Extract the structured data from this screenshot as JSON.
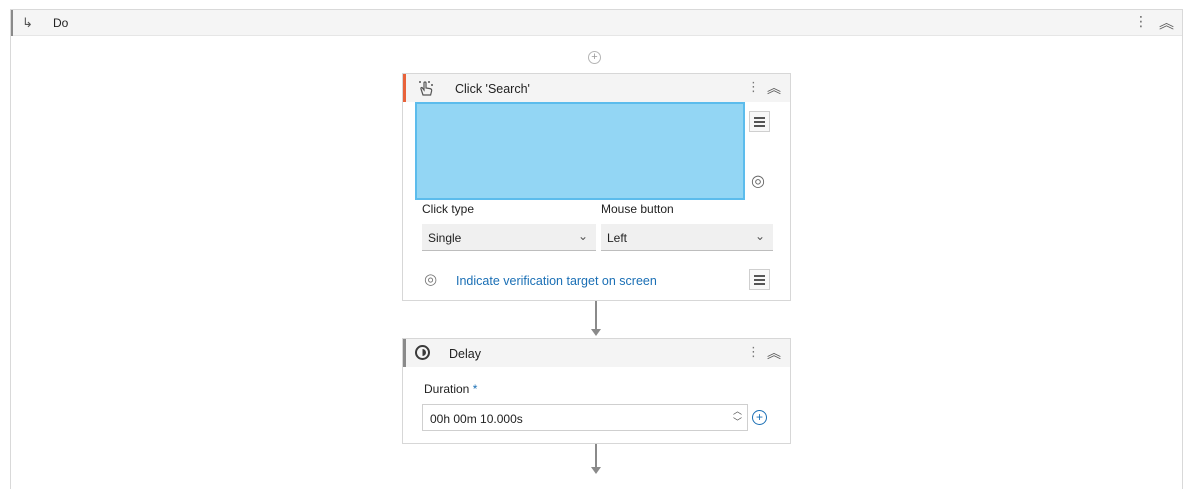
{
  "sequence": {
    "title": "Do",
    "icon": "branch-arrow-icon"
  },
  "click_activity": {
    "title": "Click 'Search'",
    "icon": "click-hand-icon",
    "accent_color": "#e8623a",
    "target_color": "#93d6f4",
    "click_type": {
      "label": "Click type",
      "value": "Single"
    },
    "mouse_button": {
      "label": "Mouse button",
      "value": "Left"
    },
    "verification_link": "Indicate verification target on screen"
  },
  "delay_activity": {
    "title": "Delay",
    "icon": "clock-icon",
    "accent_color": "#8a8a8a",
    "duration": {
      "label": "Duration",
      "required_marker": "*",
      "value": "00h 00m 10.000s"
    }
  }
}
